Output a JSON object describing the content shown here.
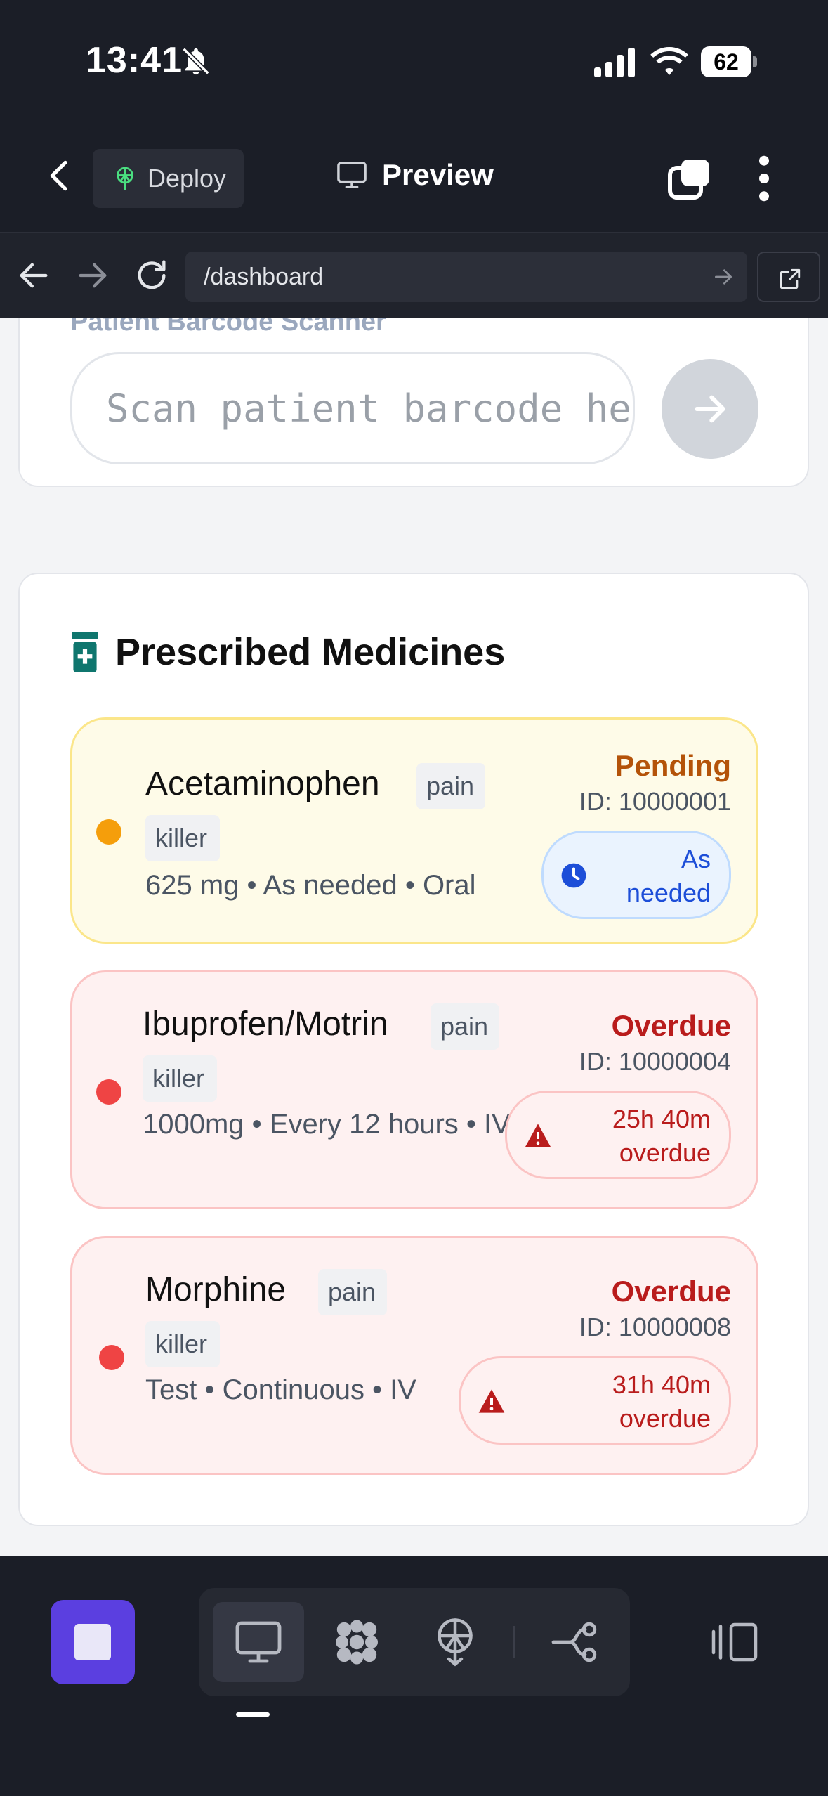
{
  "status_bar": {
    "time": "13:41",
    "battery": "62"
  },
  "header": {
    "deploy_label": "Deploy",
    "preview_label": "Preview"
  },
  "browser": {
    "url": "/dashboard"
  },
  "scanner": {
    "label": "Patient Barcode Scanner",
    "placeholder": "Scan patient barcode here"
  },
  "medicines": {
    "title": "Prescribed Medicines",
    "items": [
      {
        "name": "Acetaminophen",
        "tag": "pain killer",
        "details": "625 mg • As needed • Oral",
        "status": "Pending",
        "id": "ID: 10000001",
        "pill": "As needed"
      },
      {
        "name": "Ibuprofen/Motrin",
        "tag": "pain killer",
        "details": "1000mg • Every 12 hours • IV",
        "status": "Overdue",
        "id": "ID: 10000004",
        "pill": "25h 40m overdue"
      },
      {
        "name": "Morphine",
        "tag": "pain killer",
        "details": "Test • Continuous • IV",
        "status": "Overdue",
        "id": "ID: 10000008",
        "pill": "31h 40m overdue"
      }
    ]
  },
  "colors": {
    "pending_accent": "#f59e0b",
    "overdue_accent": "#ef4444",
    "pending_text": "#b45309",
    "overdue_text": "#b91c1c",
    "stop_button": "#5b3fe0"
  },
  "icons": {
    "status": [
      "bell-slash-icon",
      "signal-icon",
      "wifi-icon",
      "battery-icon"
    ],
    "header": [
      "chevron-left-icon",
      "deploy-icon",
      "monitor-icon",
      "tabs-icon",
      "more-vertical-icon"
    ],
    "browser": [
      "arrow-left-icon",
      "arrow-right-icon",
      "reload-icon",
      "external-link-icon"
    ],
    "toolbar": [
      "stop-icon",
      "desktop-icon",
      "apps-icon",
      "deploy-icon",
      "workflow-icon",
      "panel-icon"
    ]
  }
}
